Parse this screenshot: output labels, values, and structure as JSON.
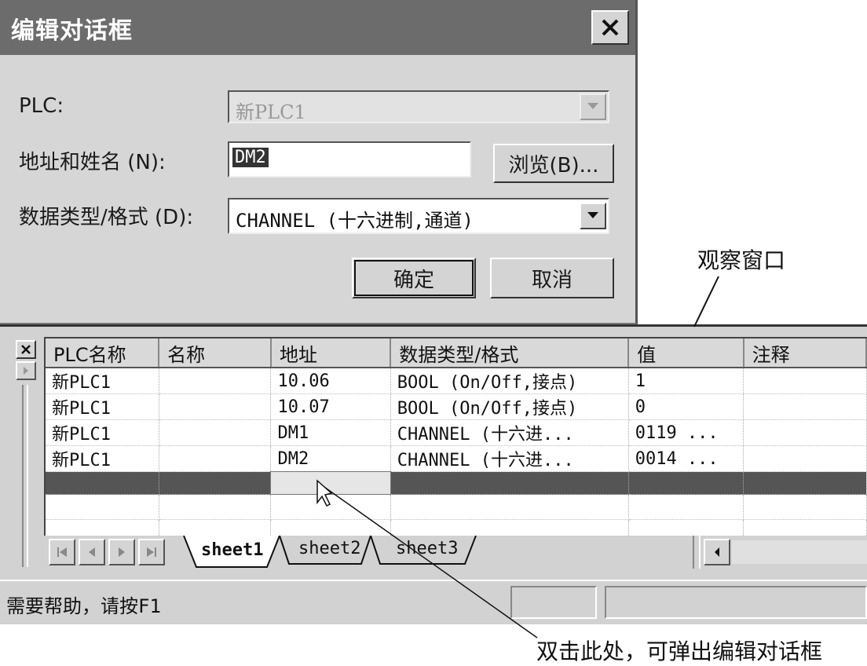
{
  "dialog": {
    "title": "编辑对话框",
    "plc_label": "PLC:",
    "plc_value": "新PLC1",
    "address_label": "地址和姓名 (N):",
    "address_value": "DM2",
    "browse_label": "浏览(B)...",
    "datatype_label": "数据类型/格式 (D):",
    "datatype_value": "CHANNEL (十六进制,通道)",
    "ok_label": "确定",
    "cancel_label": "取消"
  },
  "watch": {
    "columns": [
      "PLC名称",
      "名称",
      "地址",
      "数据类型/格式",
      "值",
      "注释"
    ],
    "rows": [
      [
        "新PLC1",
        "",
        "10.06",
        "BOOL (On/Off,接点)",
        "1",
        ""
      ],
      [
        "新PLC1",
        "",
        "10.07",
        "BOOL (On/Off,接点)",
        "0",
        ""
      ],
      [
        "新PLC1",
        "",
        "DM1",
        "CHANNEL (十六进...",
        "0119 ...",
        ""
      ],
      [
        "新PLC1",
        "",
        "DM2",
        "CHANNEL (十六进...",
        "0014 ...",
        ""
      ]
    ],
    "tabs": [
      "sheet1",
      "sheet2",
      "sheet3"
    ],
    "active_tab": "sheet1"
  },
  "status": {
    "help_text": "需要帮助，请按F1"
  },
  "annotations": {
    "watch_window": "观察窗口",
    "double_click_hint": "双击此处，可弹出编辑对话框"
  },
  "icons": {
    "close": "close-icon",
    "dropdown": "chevron-down-icon",
    "nav_first": "first-icon",
    "nav_prev": "prev-icon",
    "nav_next": "next-icon",
    "nav_last": "last-icon",
    "scroll_left": "scroll-left-icon",
    "panel_close": "panel-close-icon"
  }
}
